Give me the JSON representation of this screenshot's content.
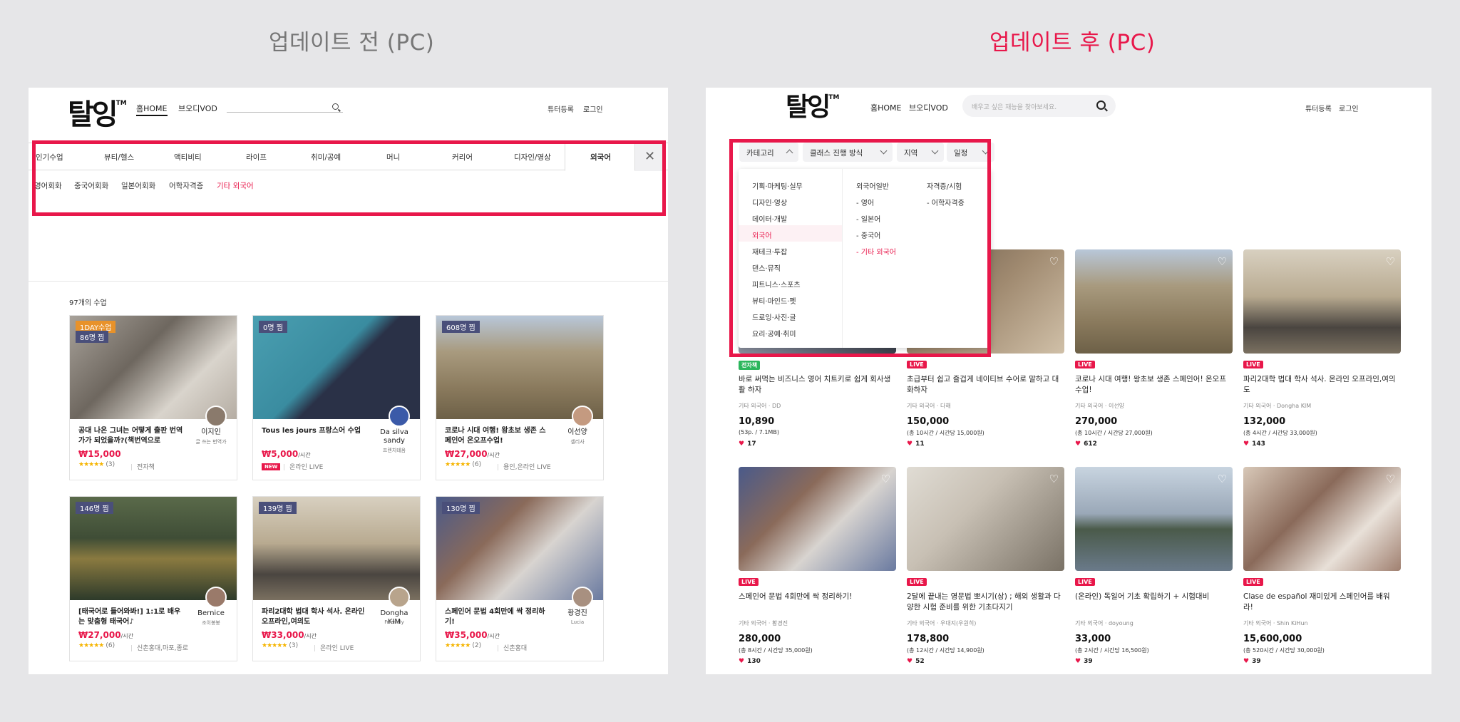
{
  "headings": {
    "before": "업데이트 전 (PC)",
    "after": "업데이트 후 (PC)"
  },
  "colors": {
    "accent": "#e8174a",
    "background": "#e6e6e8"
  },
  "left": {
    "logo": "탈잉",
    "logo_mark": "TM",
    "nav": [
      "홈HOME",
      "브오디VOD"
    ],
    "top_links": [
      "튜터등록",
      "로그인"
    ],
    "categories": [
      "인기수업",
      "뷰티/헬스",
      "액티비티",
      "라이프",
      "취미/공예",
      "머니",
      "커리어",
      "디자인/영상",
      "외국어"
    ],
    "subcategories": [
      "영어회화",
      "중국어회화",
      "일본어회화",
      "어학자격증",
      "기타 외국어"
    ],
    "close_icon": "close-icon",
    "count": "97개의 수업",
    "cards": [
      {
        "badge": "1DAY수업",
        "badge2": "86명 찜",
        "title": "공대 나온 그녀는 어떻게 출판 번역가가 되었을까?(책번역으로",
        "tutor": "이지인",
        "tutor_sub": "글 쓰는 번역가",
        "price": "₩15,000",
        "unit": "",
        "stars": "★★★★★",
        "reviews": "(3)",
        "loc": "전자책"
      },
      {
        "badge": "0명 찜",
        "title": "Tous les jours 프랑스어 수업",
        "tutor": "Da silva sandy",
        "tutor_sub": "프렌치테움",
        "price": "₩5,000",
        "unit": "/시간",
        "new": "NEW",
        "loc": "온라인 LIVE"
      },
      {
        "badge": "608명 찜",
        "title": "코로나 시대 여행! 왕초보 생존 스페인어 온오프수업!",
        "tutor": "이선양",
        "tutor_sub": "셀리사",
        "price": "₩27,000",
        "unit": "/시간",
        "stars": "★★★★★",
        "reviews": "(6)",
        "loc": "용인,온라인 LIVE"
      },
      {
        "badge": "146명 찜",
        "title": "[태국어로 들어와봐!] 1:1로 배우는 맞춤형 태국어♪",
        "tutor": "Bernice",
        "tutor_sub": "조이봉봉",
        "price": "₩27,000",
        "unit": "/시간",
        "stars": "★★★★★",
        "reviews": "(6)",
        "loc": "신촌홍대,마포,종로"
      },
      {
        "badge": "139명 찜",
        "title": "파리2대학 법대 학사 석사. 온라인 오프라인,여의도",
        "tutor": "Dongha KIM",
        "tutor_sub": "Friendly",
        "price": "₩33,000",
        "unit": "/시간",
        "stars": "★★★★★",
        "reviews": "(3)",
        "loc": "온라인 LIVE"
      },
      {
        "badge": "130명 찜",
        "title": "스페인어 문법 4회만에 싹 정리하기!",
        "tutor": "황경진",
        "tutor_sub": "Lucia",
        "price": "₩35,000",
        "unit": "/시간",
        "stars": "★★★★★",
        "reviews": "(2)",
        "loc": "신촌홍대"
      }
    ]
  },
  "right": {
    "logo": "탈잉",
    "logo_mark": "TM",
    "nav": [
      "홈HOME",
      "브오디VOD"
    ],
    "search_placeholder": "배우고 싶은 재능을 찾아보세요.",
    "top_links": [
      "튜터등록",
      "로그인"
    ],
    "filters": [
      "카테고리",
      "클래스 진행 방식",
      "지역",
      "일정"
    ],
    "dropdown_main": [
      "기획·마케팅·실무",
      "디자인·영상",
      "데이터·개발",
      "외국어",
      "재테크·투잡",
      "댄스·뮤직",
      "피트니스·스포츠",
      "뷰티·마인드·펫",
      "드로잉·사진·글",
      "요리·공예·취미"
    ],
    "dropdown_sub_a": [
      "외국어일반",
      "- 영어",
      "- 일본어",
      "- 중국어",
      "- 기타 외국어"
    ],
    "dropdown_sub_b": [
      "자격증/시험",
      "- 어학자격증"
    ],
    "cards": [
      {
        "live": "전자책",
        "title": "바로 써먹는 비즈니스 영어 치트키로 쉽게 회사생활 하자",
        "sub": "기타 외국어 · DD",
        "price": "10,890",
        "detail": "(53p. / 7.1MB)",
        "likes": "17"
      },
      {
        "live": "LIVE",
        "title": "초급부터 쉽고 즐겁게 네이티브 수어로 말하고 대화하자",
        "sub": "기타 외국어 · 다해",
        "price": "150,000",
        "detail": "(총 10시간 / 시간당 15,000원)",
        "likes": "11"
      },
      {
        "live": "LIVE",
        "title": "코로나 시대 여행! 왕초보 생존 스페인어! 온오프수업!",
        "sub": "기타 외국어 · 이선양",
        "price": "270,000",
        "detail": "(총 10시간 / 시간당 27,000원)",
        "likes": "612"
      },
      {
        "live": "LIVE",
        "title": "파리2대학 법대 학사 석사. 온라인 오프라인,여의도",
        "sub": "기타 외국어 · Dongha KIM",
        "price": "132,000",
        "detail": "(총 4시간 / 시간당 33,000원)",
        "likes": "143"
      },
      {
        "live": "LIVE",
        "title": "스페인어 문법 4회만에 싹 정리하기!",
        "sub": "기타 외국어 · 황경진",
        "price": "280,000",
        "detail": "(총 8시간 / 시간당 35,000원)",
        "likes": "130"
      },
      {
        "live": "LIVE",
        "title": "2달에 끝내는 영문법 뽀시기(상) ; 해외 생활과 다양한 시험 준비를 위한 기초다지기",
        "sub": "기타 외국어 · 우대지(우원히)",
        "price": "178,800",
        "detail": "(총 12시간 / 시간당 14,900원)",
        "likes": "52"
      },
      {
        "live": "LIVE",
        "title": "(온라인) 독일어 기초 확립하기 + 시험대비",
        "sub": "기타 외국어 · doyoung",
        "price": "33,000",
        "detail": "(총 2시간 / 시간당 16,500원)",
        "likes": "39"
      },
      {
        "live": "LIVE",
        "title": "Clase de español 재미있게 스페인어를 배워라!",
        "sub": "기타 외국어 · Shin KiHun",
        "price": "15,600,000",
        "detail": "(총 520시간 / 시간당 30,000원)",
        "likes": "39"
      }
    ]
  }
}
